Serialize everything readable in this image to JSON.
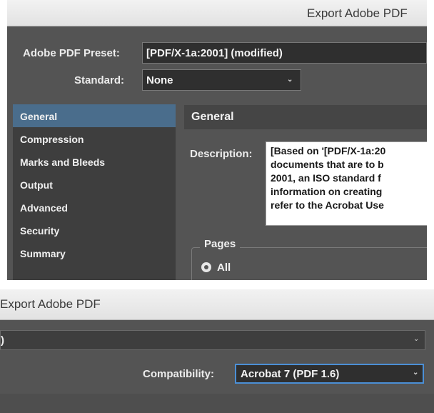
{
  "window": {
    "title": "Export Adobe PDF"
  },
  "preset": {
    "label": "Adobe PDF Preset:",
    "value": "[PDF/X-1a:2001] (modified)"
  },
  "standard": {
    "label": "Standard:",
    "value": "None"
  },
  "sidebar": {
    "items": [
      {
        "label": "General",
        "active": true
      },
      {
        "label": "Compression",
        "active": false
      },
      {
        "label": "Marks and Bleeds",
        "active": false
      },
      {
        "label": "Output",
        "active": false
      },
      {
        "label": "Advanced",
        "active": false
      },
      {
        "label": "Security",
        "active": false
      },
      {
        "label": "Summary",
        "active": false
      }
    ]
  },
  "section": {
    "title": "General",
    "description_label": "Description:",
    "description_text": "[Based on '[PDF/X-1a:20\ndocuments that are to b\n2001, an ISO standard f\ninformation on creating\nrefer to the Acrobat Use"
  },
  "pages": {
    "legend": "Pages",
    "option_all": "All"
  },
  "panel2": {
    "window_title": "Export Adobe PDF",
    "preset_row_text": ")",
    "compatibility_label": "Compatibility:",
    "compatibility_value": "Acrobat 7 (PDF 1.6)"
  },
  "icons": {
    "dropdown": "chevron-down-icon"
  },
  "colors": {
    "selection": "#4a6d8c",
    "focus_ring": "#4b8fd6",
    "panel_bg": "#545454"
  }
}
